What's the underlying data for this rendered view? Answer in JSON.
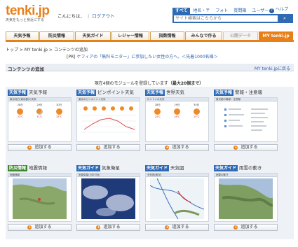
{
  "header": {
    "logo": "tenki.jp",
    "tagline": "天気をもっと身近にする",
    "greeting": "こんにちは、",
    "logout": "ログアウト",
    "help": "ヘルプ",
    "search_tabs": [
      "すべて",
      "地名・〒",
      "フォト",
      "質問箱",
      "ユーザー"
    ],
    "search_placeholder": "サイト検索はこちらから"
  },
  "nav": [
    "天気予報",
    "防災情報",
    "天気ガイド",
    "レジャー情報",
    "指数情報",
    "みんなで作る",
    "公開データ",
    "MY tenki.jp"
  ],
  "breadcrumb": [
    "トップ",
    "MY tenki.jp",
    "コンテンツの追加"
  ],
  "pr": {
    "prefix": "[PR]",
    "text": "ケフィアの「無料モニター」に参加したい女性の方へ。＜先着1000名様＞"
  },
  "content": {
    "title": "コンテンツの追加",
    "back_link": "MY tenki.jpに戻る",
    "count_text_prefix": "現在4個のモジュールを登録しています",
    "count_text_max": "（最大20個まで）"
  },
  "modules": [
    {
      "badge": "天気予報",
      "title": "天気予報",
      "thumb_title": "東京地方(東京都)の天気",
      "add": "追加する"
    },
    {
      "badge": "天気予報",
      "title": "ピンポイント天気",
      "thumb_title": "東京のピンポイント天気",
      "add": "追加する"
    },
    {
      "badge": "天気予報",
      "title": "世界天気",
      "thumb_title": "ロンドンの天気",
      "add": "追加する"
    },
    {
      "badge": "天気予報",
      "title": "警報・注意報",
      "thumb_title": "東京都の警報・注意報",
      "add": "追加する"
    },
    {
      "badge": "防災情報",
      "title": "地震情報",
      "thumb_title": "地震情報",
      "add": "追加する"
    },
    {
      "badge": "天気ガイド",
      "title": "気象衛星",
      "thumb_title": "気象衛星(日本付近)",
      "add": "追加する"
    },
    {
      "badge": "天気ガイド",
      "title": "天気図",
      "thumb_title": "天気図(実況)",
      "add": "追加する"
    },
    {
      "badge": "天気ガイド",
      "title": "雨雲の動き",
      "thumb_title": "雨雲の動き",
      "add": "追加する"
    }
  ],
  "colors": {
    "accent": "#e8801a",
    "brand_blue": "#2f6bb5",
    "disaster_green": "#3e8a2e"
  }
}
